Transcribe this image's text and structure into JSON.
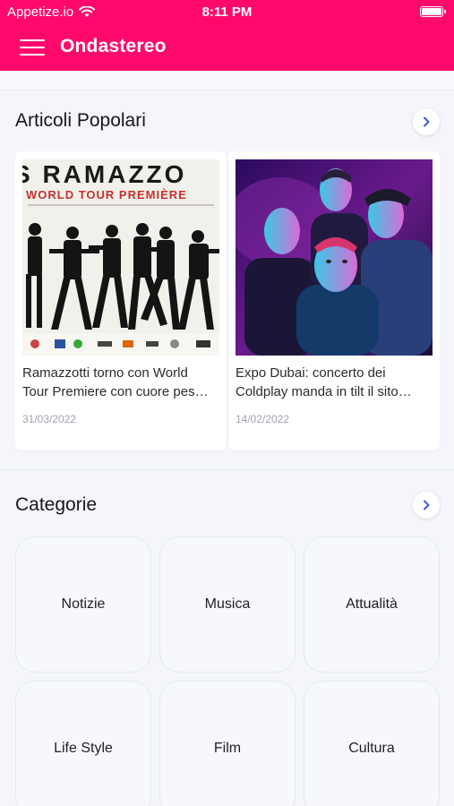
{
  "status_bar": {
    "carrier": "Appetize.io",
    "time": "8:11 PM",
    "icons": [
      "wifi-icon",
      "battery-icon"
    ]
  },
  "app_bar": {
    "title": "Ondastereo",
    "menu_icon": "hamburger-menu-icon"
  },
  "colors": {
    "brand": "#ff0a6c",
    "background": "#f4f6fb",
    "chevron": "#3d5bd9"
  },
  "popular": {
    "title": "Articoli Popolari",
    "more_icon": "chevron-right-icon",
    "articles": [
      {
        "title_line1": "Ramazzotti torno con World",
        "title_line2": "Tour Premiere con cuore pes…",
        "date": "31/03/2022",
        "image_banner": "S RAMAZZO",
        "image_subtitle": "WORLD TOUR PREMIÈRE"
      },
      {
        "title_line1": "Expo Dubai: concerto dei",
        "title_line2": "Coldplay manda in tilt il sito…",
        "date": "14/02/2022"
      }
    ]
  },
  "categories": {
    "title": "Categorie",
    "more_icon": "chevron-right-icon",
    "items": [
      "Notizie",
      "Musica",
      "Attualità",
      "Life Style",
      "Film",
      "Cultura"
    ]
  }
}
